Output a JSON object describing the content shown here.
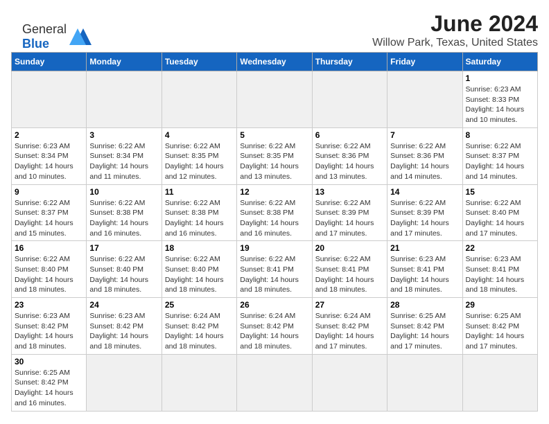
{
  "logo": {
    "text_general": "General",
    "text_blue": "Blue"
  },
  "header": {
    "month_year": "June 2024",
    "location": "Willow Park, Texas, United States"
  },
  "days_of_week": [
    "Sunday",
    "Monday",
    "Tuesday",
    "Wednesday",
    "Thursday",
    "Friday",
    "Saturday"
  ],
  "weeks": [
    [
      {
        "day": "",
        "info": "",
        "empty": true
      },
      {
        "day": "",
        "info": "",
        "empty": true
      },
      {
        "day": "",
        "info": "",
        "empty": true
      },
      {
        "day": "",
        "info": "",
        "empty": true
      },
      {
        "day": "",
        "info": "",
        "empty": true
      },
      {
        "day": "",
        "info": "",
        "empty": true
      },
      {
        "day": "1",
        "info": "Sunrise: 6:23 AM\nSunset: 8:33 PM\nDaylight: 14 hours and 10 minutes."
      }
    ],
    [
      {
        "day": "2",
        "info": "Sunrise: 6:23 AM\nSunset: 8:34 PM\nDaylight: 14 hours and 10 minutes."
      },
      {
        "day": "3",
        "info": "Sunrise: 6:22 AM\nSunset: 8:34 PM\nDaylight: 14 hours and 11 minutes."
      },
      {
        "day": "4",
        "info": "Sunrise: 6:22 AM\nSunset: 8:35 PM\nDaylight: 14 hours and 12 minutes."
      },
      {
        "day": "5",
        "info": "Sunrise: 6:22 AM\nSunset: 8:35 PM\nDaylight: 14 hours and 13 minutes."
      },
      {
        "day": "6",
        "info": "Sunrise: 6:22 AM\nSunset: 8:36 PM\nDaylight: 14 hours and 13 minutes."
      },
      {
        "day": "7",
        "info": "Sunrise: 6:22 AM\nSunset: 8:36 PM\nDaylight: 14 hours and 14 minutes."
      },
      {
        "day": "8",
        "info": "Sunrise: 6:22 AM\nSunset: 8:37 PM\nDaylight: 14 hours and 14 minutes."
      }
    ],
    [
      {
        "day": "9",
        "info": "Sunrise: 6:22 AM\nSunset: 8:37 PM\nDaylight: 14 hours and 15 minutes."
      },
      {
        "day": "10",
        "info": "Sunrise: 6:22 AM\nSunset: 8:38 PM\nDaylight: 14 hours and 16 minutes."
      },
      {
        "day": "11",
        "info": "Sunrise: 6:22 AM\nSunset: 8:38 PM\nDaylight: 14 hours and 16 minutes."
      },
      {
        "day": "12",
        "info": "Sunrise: 6:22 AM\nSunset: 8:38 PM\nDaylight: 14 hours and 16 minutes."
      },
      {
        "day": "13",
        "info": "Sunrise: 6:22 AM\nSunset: 8:39 PM\nDaylight: 14 hours and 17 minutes."
      },
      {
        "day": "14",
        "info": "Sunrise: 6:22 AM\nSunset: 8:39 PM\nDaylight: 14 hours and 17 minutes."
      },
      {
        "day": "15",
        "info": "Sunrise: 6:22 AM\nSunset: 8:40 PM\nDaylight: 14 hours and 17 minutes."
      }
    ],
    [
      {
        "day": "16",
        "info": "Sunrise: 6:22 AM\nSunset: 8:40 PM\nDaylight: 14 hours and 18 minutes."
      },
      {
        "day": "17",
        "info": "Sunrise: 6:22 AM\nSunset: 8:40 PM\nDaylight: 14 hours and 18 minutes."
      },
      {
        "day": "18",
        "info": "Sunrise: 6:22 AM\nSunset: 8:40 PM\nDaylight: 14 hours and 18 minutes."
      },
      {
        "day": "19",
        "info": "Sunrise: 6:22 AM\nSunset: 8:41 PM\nDaylight: 14 hours and 18 minutes."
      },
      {
        "day": "20",
        "info": "Sunrise: 6:22 AM\nSunset: 8:41 PM\nDaylight: 14 hours and 18 minutes."
      },
      {
        "day": "21",
        "info": "Sunrise: 6:23 AM\nSunset: 8:41 PM\nDaylight: 14 hours and 18 minutes."
      },
      {
        "day": "22",
        "info": "Sunrise: 6:23 AM\nSunset: 8:41 PM\nDaylight: 14 hours and 18 minutes."
      }
    ],
    [
      {
        "day": "23",
        "info": "Sunrise: 6:23 AM\nSunset: 8:42 PM\nDaylight: 14 hours and 18 minutes."
      },
      {
        "day": "24",
        "info": "Sunrise: 6:23 AM\nSunset: 8:42 PM\nDaylight: 14 hours and 18 minutes."
      },
      {
        "day": "25",
        "info": "Sunrise: 6:24 AM\nSunset: 8:42 PM\nDaylight: 14 hours and 18 minutes."
      },
      {
        "day": "26",
        "info": "Sunrise: 6:24 AM\nSunset: 8:42 PM\nDaylight: 14 hours and 18 minutes."
      },
      {
        "day": "27",
        "info": "Sunrise: 6:24 AM\nSunset: 8:42 PM\nDaylight: 14 hours and 17 minutes."
      },
      {
        "day": "28",
        "info": "Sunrise: 6:25 AM\nSunset: 8:42 PM\nDaylight: 14 hours and 17 minutes."
      },
      {
        "day": "29",
        "info": "Sunrise: 6:25 AM\nSunset: 8:42 PM\nDaylight: 14 hours and 17 minutes."
      }
    ],
    [
      {
        "day": "30",
        "info": "Sunrise: 6:25 AM\nSunset: 8:42 PM\nDaylight: 14 hours and 16 minutes.",
        "last_row": true
      },
      {
        "day": "",
        "info": "",
        "empty": true,
        "last_row": true
      },
      {
        "day": "",
        "info": "",
        "empty": true,
        "last_row": true
      },
      {
        "day": "",
        "info": "",
        "empty": true,
        "last_row": true
      },
      {
        "day": "",
        "info": "",
        "empty": true,
        "last_row": true
      },
      {
        "day": "",
        "info": "",
        "empty": true,
        "last_row": true
      },
      {
        "day": "",
        "info": "",
        "empty": true,
        "last_row": true
      }
    ]
  ]
}
